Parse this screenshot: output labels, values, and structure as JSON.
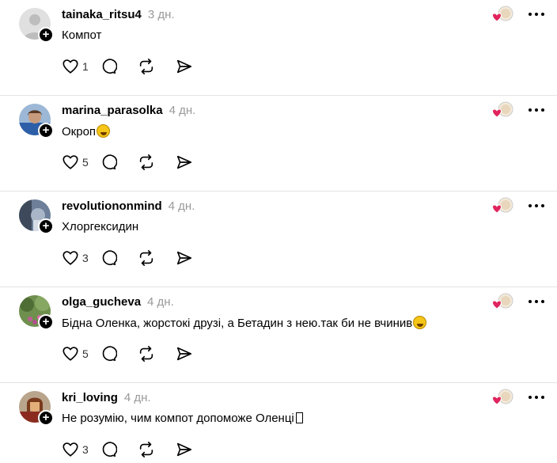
{
  "comments": [
    {
      "username": "tainaka_ritsu4",
      "time": "3 дн.",
      "text": "Компот",
      "trailing": "",
      "likes": "1",
      "avatar": {
        "kind": "default",
        "bg": "#e0e0e0",
        "fg": "#bfbfbf"
      }
    },
    {
      "username": "marina_parasolka",
      "time": "4 дн.",
      "text": "Окроп",
      "trailing": "emoji",
      "likes": "5",
      "avatar": {
        "kind": "photo",
        "bg": "#7fa3c7",
        "fg": "#c89b7d"
      }
    },
    {
      "username": "revolutiononmind",
      "time": "4 дн.",
      "text": "Хлоргексидин",
      "trailing": "",
      "likes": "3",
      "avatar": {
        "kind": "photo",
        "bg": "#5c6e8a",
        "fg": "#a9b6c8"
      }
    },
    {
      "username": "olga_gucheva",
      "time": "4 дн.",
      "text": "Бідна Оленка, жорстокі друзі, а Бетадин з нею.так би не вчинив",
      "trailing": "emoji",
      "likes": "5",
      "avatar": {
        "kind": "photo",
        "bg": "#6f8f4e",
        "fg": "#c05b9a"
      }
    },
    {
      "username": "kri_loving",
      "time": "4 дн.",
      "text": "Не розумію, чим компот допоможе Оленці",
      "trailing": "tofu",
      "likes": "3",
      "avatar": {
        "kind": "photo",
        "bg": "#8b2b1f",
        "fg": "#e3b07a"
      }
    }
  ],
  "icons": {
    "like": "heart-icon",
    "reply": "comment-bubble-icon",
    "repost": "repost-icon",
    "share": "share-send-icon",
    "reacted": "author-liked-badge",
    "more": "more-options-icon"
  },
  "colors": {
    "heart": "#e0245e",
    "muted": "#999999",
    "divider": "#e3e3e3"
  }
}
